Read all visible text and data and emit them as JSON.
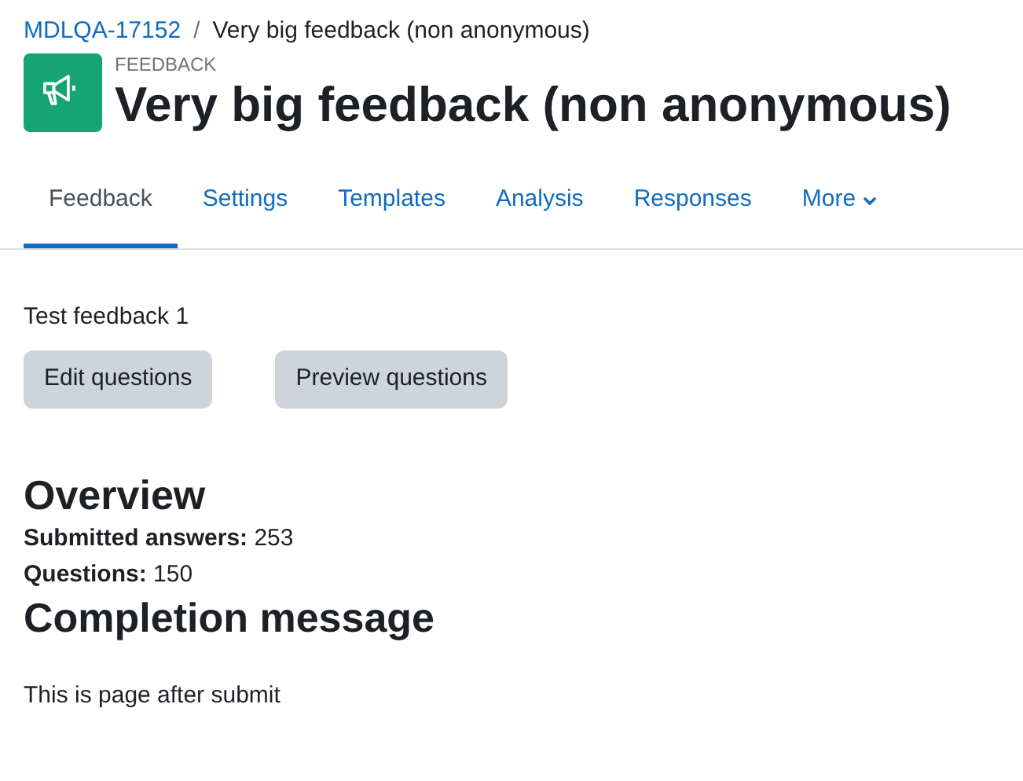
{
  "breadcrumb": [
    {
      "label": "MDLQA-17152",
      "kind": "link"
    },
    {
      "label": "Very big feedback (non anonymous)",
      "kind": "current",
      "separator": "/"
    }
  ],
  "header": {
    "module_label": "FEEDBACK",
    "title": "Very big feedback (non anonymous)"
  },
  "tabs": [
    {
      "label": "Feedback",
      "selected": true
    },
    {
      "label": "Settings",
      "selected": false
    },
    {
      "label": "Templates",
      "selected": false
    },
    {
      "label": "Analysis",
      "selected": false
    },
    {
      "label": "Responses",
      "selected": false
    },
    {
      "label": "More",
      "selected": false,
      "kind": "dropdown"
    }
  ],
  "intro": "Test feedback 1",
  "buttons": [
    "Edit questions",
    "Preview questions"
  ],
  "overview": {
    "heading": "Overview",
    "stats": [
      {
        "label": "Submitted answers:",
        "value": "253"
      },
      {
        "label": "Questions:",
        "value": "150"
      }
    ]
  },
  "completion": {
    "heading": "Completion message",
    "text": "This is page after submit"
  }
}
